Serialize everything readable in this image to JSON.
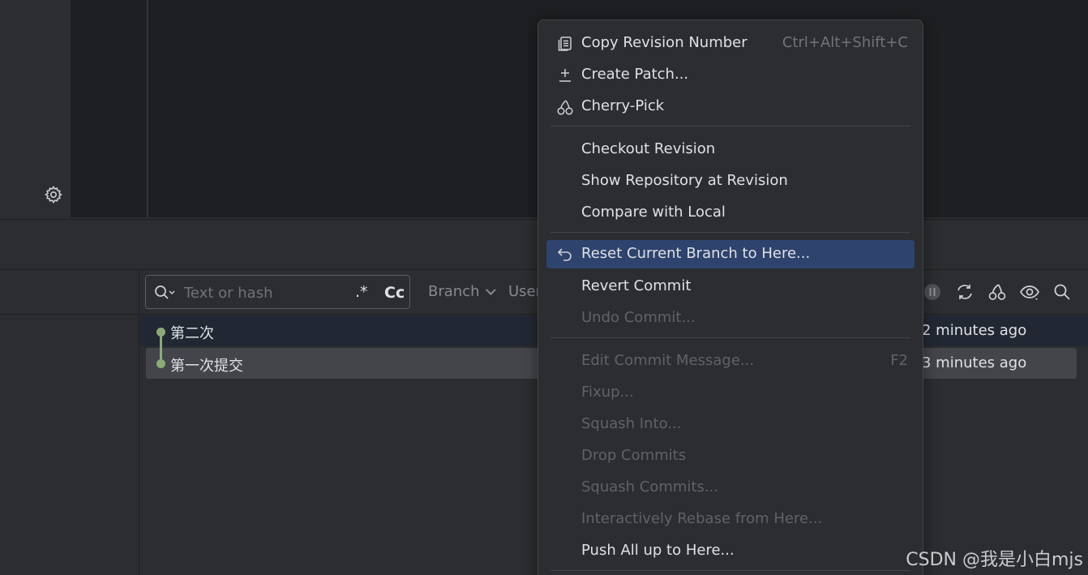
{
  "search": {
    "placeholder": "Text or hash",
    "regex_label": ".*",
    "case_label": "Cc"
  },
  "filters": {
    "branch_label": "Branch",
    "user_label": "User"
  },
  "toolbar_icons": [
    "pause-icon",
    "refresh-icon",
    "cherry-pick-icon",
    "eye-icon",
    "search-icon"
  ],
  "commits": [
    {
      "message": "第二次",
      "time": "2 minutes ago"
    },
    {
      "message": "第一次提交",
      "time": "3 minutes ago"
    }
  ],
  "menu": {
    "items": [
      {
        "label": "Copy Revision Number",
        "shortcut": "Ctrl+Alt+Shift+C",
        "icon": "copy-icon"
      },
      {
        "label": "Create Patch...",
        "icon": "patch-icon"
      },
      {
        "label": "Cherry-Pick",
        "icon": "cherry-icon"
      },
      {
        "label": "Checkout Revision"
      },
      {
        "label": "Show Repository at Revision"
      },
      {
        "label": "Compare with Local"
      },
      {
        "label": "Reset Current Branch to Here...",
        "icon": "undo-icon"
      },
      {
        "label": "Revert Commit"
      },
      {
        "label": "Undo Commit..."
      },
      {
        "label": "Edit Commit Message...",
        "shortcut": "F2"
      },
      {
        "label": "Fixup..."
      },
      {
        "label": "Squash Into..."
      },
      {
        "label": "Drop Commits"
      },
      {
        "label": "Squash Commits..."
      },
      {
        "label": "Interactively Rebase from Here..."
      },
      {
        "label": "Push All up to Here..."
      }
    ]
  },
  "watermark": "CSDN @我是小白mjs",
  "colors": {
    "selection": "#2e436e",
    "graph": "#8aab78",
    "editor_bg": "#1e1f22",
    "panel_bg": "#2b2d30"
  }
}
